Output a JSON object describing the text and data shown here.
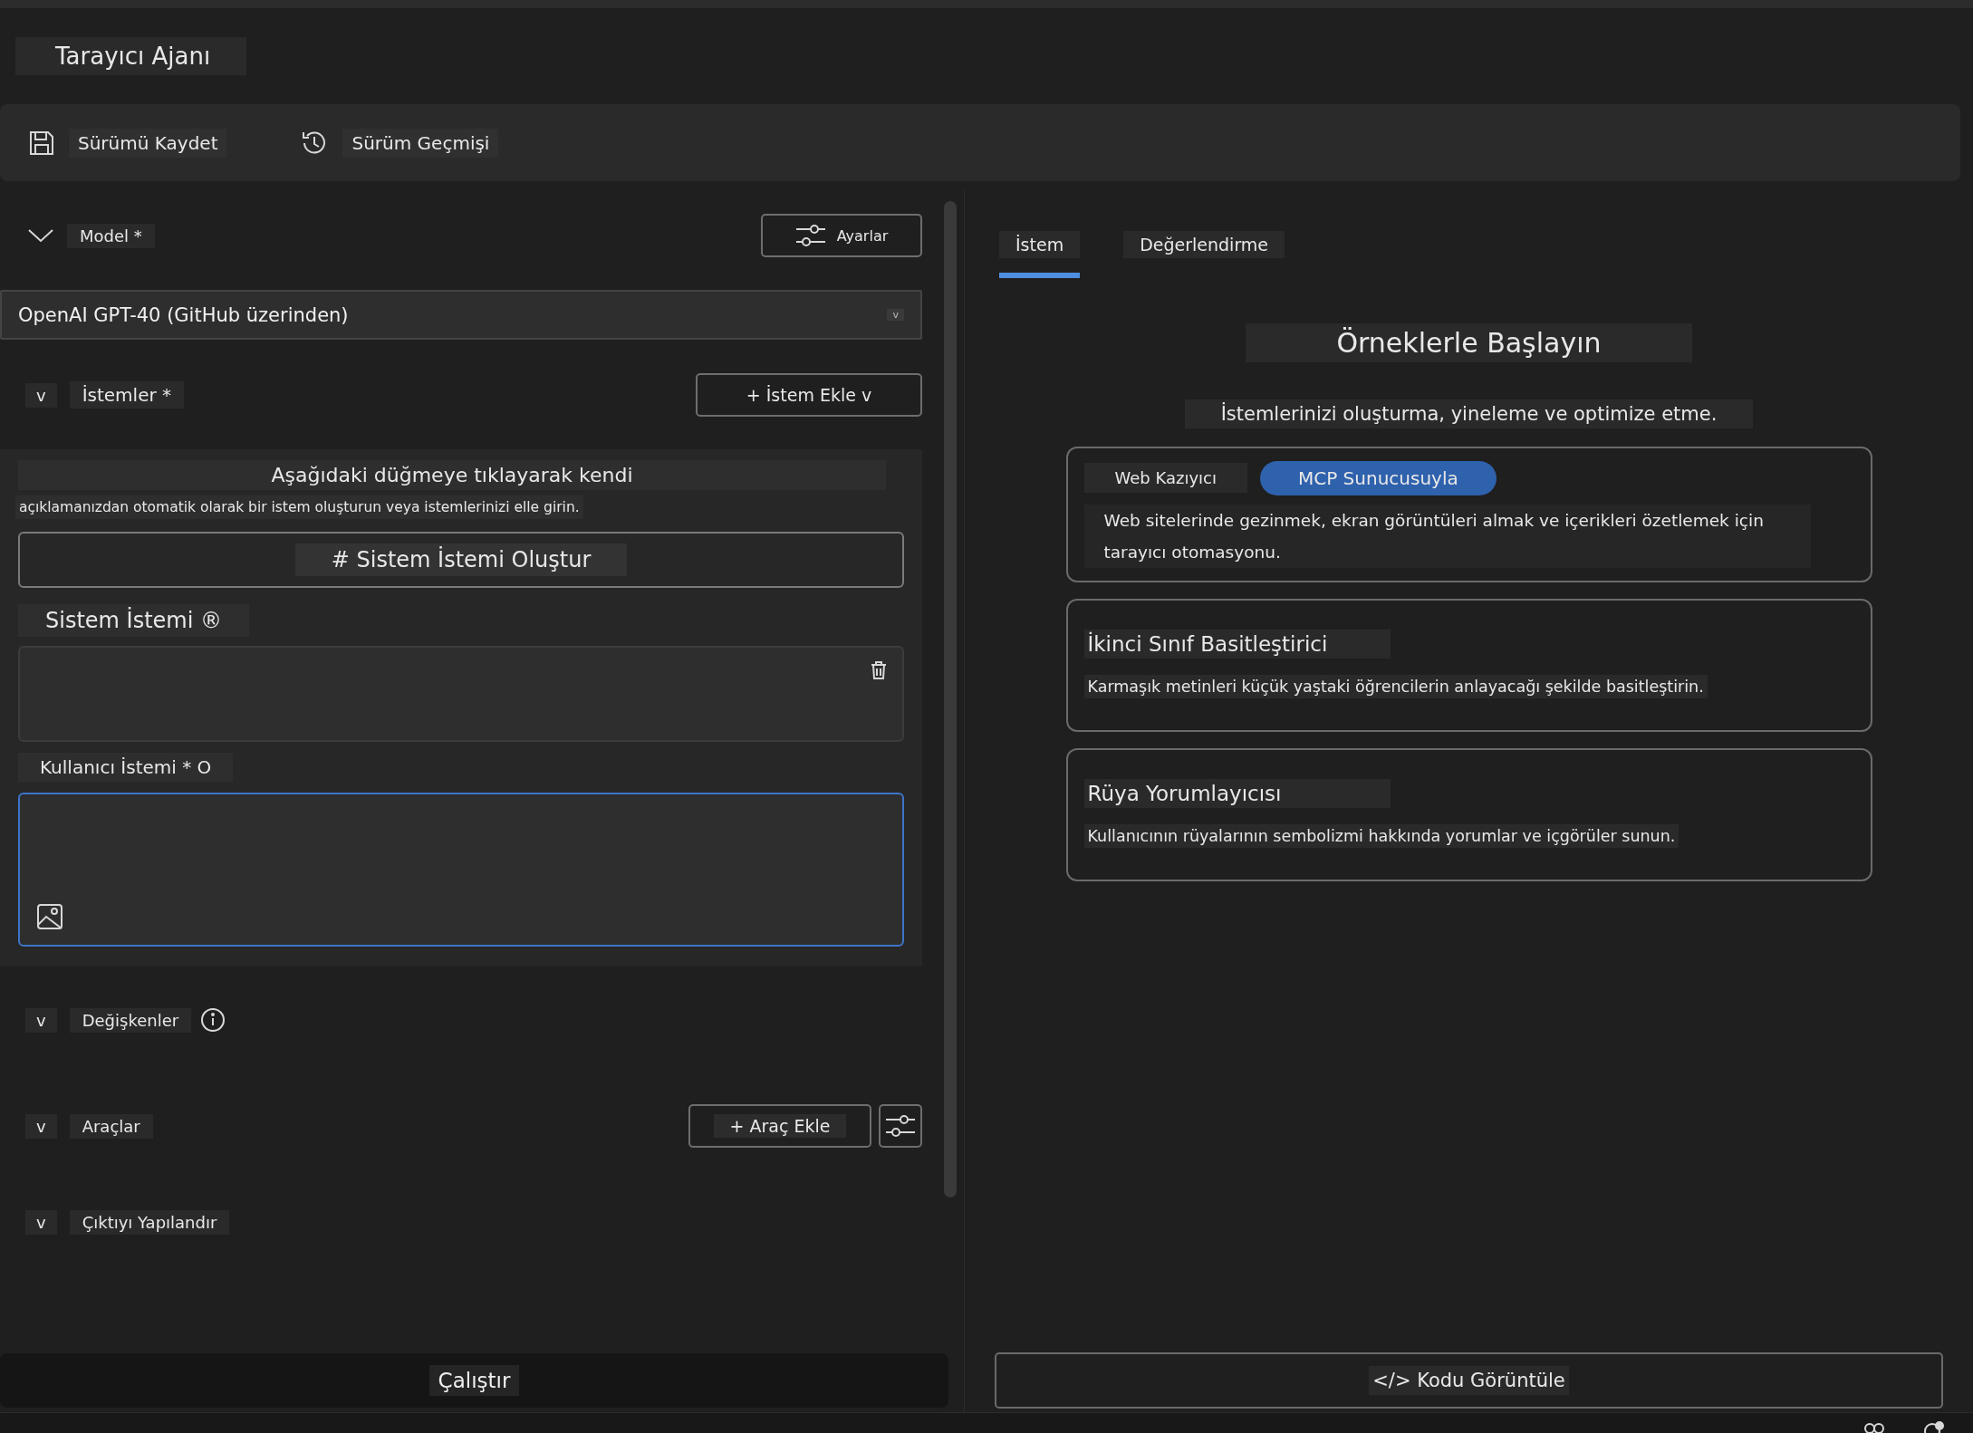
{
  "app_title": "Tarayıcı Ajanı",
  "toolbar": [
    {
      "label": "Sürümü Kaydet"
    },
    {
      "label": "Sürüm Geçmişi"
    }
  ],
  "model": {
    "label": "Model *",
    "expanded": true,
    "settings_button": "Ayarlar",
    "value": "OpenAI GPT-40 (GitHub üzerinden)",
    "dropdown_caret": "v"
  },
  "prompts": {
    "toggle": "v",
    "label": "İstemler *",
    "add_button": "+ İstem Ekle v",
    "intro_heading": "Aşağıdaki düğmeye tıklayarak kendi",
    "intro_text": "açıklamanızdan otomatik olarak bir istem oluşturun veya istemlerinizi elle girin.",
    "generate_button": "# Sistem İstemi Oluştur",
    "system_label": "Sistem İstemi ®",
    "user_label": "Kullanıcı İstemi * O",
    "user_focused": true
  },
  "sections": [
    {
      "toggle": "v",
      "label": "Değişkenler",
      "kind": "info"
    },
    {
      "toggle": "v",
      "label": "Araçlar",
      "kind": "tools",
      "add_button": "+ Araç Ekle"
    },
    {
      "toggle": "v",
      "label": "Çıktıyı Yapılandır",
      "kind": "plain"
    }
  ],
  "run_button": "Çalıştır",
  "tabs": [
    {
      "label": "İstem",
      "selected": true
    },
    {
      "label": "Değerlendirme",
      "selected": false
    }
  ],
  "examples": {
    "title": "Örneklerle Başlayın",
    "subtitle": "İstemlerinizi oluşturma, yineleme ve optimize etme.",
    "cards": [
      {
        "kind": "tagged",
        "tags": [
          {
            "label": "Web Kazıyıcı",
            "selected": false
          },
          {
            "label": "MCP Sunucusuyla",
            "selected": true
          }
        ],
        "description": "Web sitelerinde gezinmek, ekran görüntüleri almak ve içerikleri özetlemek için tarayıcı otomasyonu."
      },
      {
        "kind": "titled",
        "title": "İkinci Sınıf Basitleştirici",
        "description": "Karmaşık metinleri küçük yaştaki öğrencilerin anlayacağı şekilde basitleştirin."
      },
      {
        "kind": "titled",
        "title": "Rüya Yorumlayıcısı",
        "description": "Kullanıcının rüyalarının sembolizmi hakkında yorumlar ve içgörüler sunun."
      }
    ]
  },
  "view_code_button": "</> Kodu Görüntüle"
}
